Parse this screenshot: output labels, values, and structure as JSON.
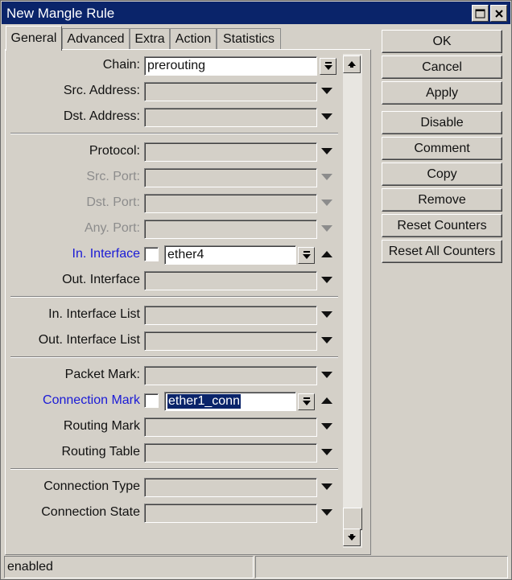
{
  "window": {
    "title": "New Mangle Rule"
  },
  "tabs": [
    {
      "label": "General"
    },
    {
      "label": "Advanced"
    },
    {
      "label": "Extra"
    },
    {
      "label": "Action"
    },
    {
      "label": "Statistics"
    }
  ],
  "form": {
    "chain": {
      "label": "Chain:",
      "value": "prerouting"
    },
    "src_address": {
      "label": "Src. Address:"
    },
    "dst_address": {
      "label": "Dst. Address:"
    },
    "protocol": {
      "label": "Protocol:"
    },
    "src_port": {
      "label": "Src. Port:"
    },
    "dst_port": {
      "label": "Dst. Port:"
    },
    "any_port": {
      "label": "Any. Port:"
    },
    "in_interface": {
      "label": "In. Interface",
      "value": "ether4",
      "negate_checked": false
    },
    "out_interface": {
      "label": "Out. Interface"
    },
    "in_interface_list": {
      "label": "In. Interface List"
    },
    "out_interface_list": {
      "label": "Out. Interface List"
    },
    "packet_mark": {
      "label": "Packet Mark:"
    },
    "connection_mark": {
      "label": "Connection Mark",
      "value": "ether1_conn",
      "negate_checked": false
    },
    "routing_mark": {
      "label": "Routing Mark"
    },
    "routing_table": {
      "label": "Routing Table"
    },
    "connection_type": {
      "label": "Connection Type"
    },
    "connection_state": {
      "label": "Connection State"
    }
  },
  "buttons": {
    "ok": "OK",
    "cancel": "Cancel",
    "apply": "Apply",
    "disable": "Disable",
    "comment": "Comment",
    "copy": "Copy",
    "remove": "Remove",
    "reset_counters": "Reset Counters",
    "reset_all_counters": "Reset All Counters"
  },
  "status_bar": {
    "text": "enabled"
  },
  "colors": {
    "title_bar": "#0a246a",
    "link_label": "#1a1ad6",
    "disabled_label": "#8c8c8c",
    "window_bg": "#d4d0c8"
  },
  "icons": [
    "maximize-icon",
    "close-icon",
    "dropdown-icon",
    "expand-arrow-icon",
    "collapse-arrow-icon",
    "scroll-up-icon",
    "scroll-down-icon"
  ]
}
